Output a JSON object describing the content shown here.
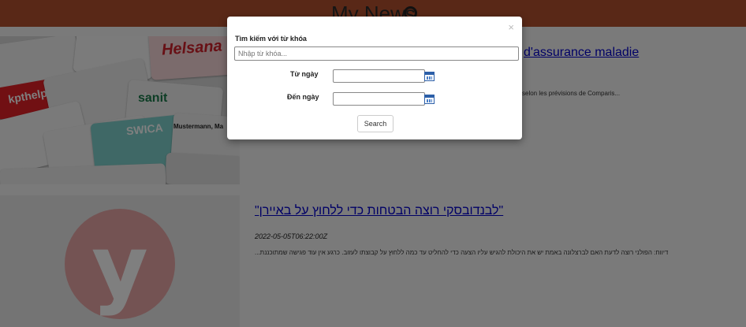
{
  "header": {
    "title": "My News"
  },
  "articles": [
    {
      "title": "d'assurance maladie",
      "snippet": "selon les prévisions de Comparis..."
    },
    {
      "title": "\"לבנדובסקי רוצה הבטחות כדי ללחוץ על באיירן\"",
      "date": "2022-05-05T06:22:00Z",
      "snippet": "דיווח: הפולני רוצה לדעת האם לברצלונה באמת יש את היכולת להגיש עליו הצעה כדי להחליט עד כמה ללחוץ על קבוצתו לעזוב. כרגע אין עוד פגישה שמתוכננת..."
    }
  ],
  "thumb_texts": {
    "kpt": "kpthelp.ch",
    "helsana": "Helsana",
    "sanitas": "sanit",
    "swica": "SWICA",
    "mustermann": "Mustermann, Ma",
    "y": "y"
  },
  "modal": {
    "close": "×",
    "keyword_label": "Tìm kiếm với từ khóa",
    "keyword_placeholder": "Nhập từ khóa...",
    "from_label": "Từ ngày",
    "to_label": "Đến ngày",
    "search_button": "Search"
  },
  "colors": {
    "header": "#b2502f",
    "link": "#0000cc"
  }
}
